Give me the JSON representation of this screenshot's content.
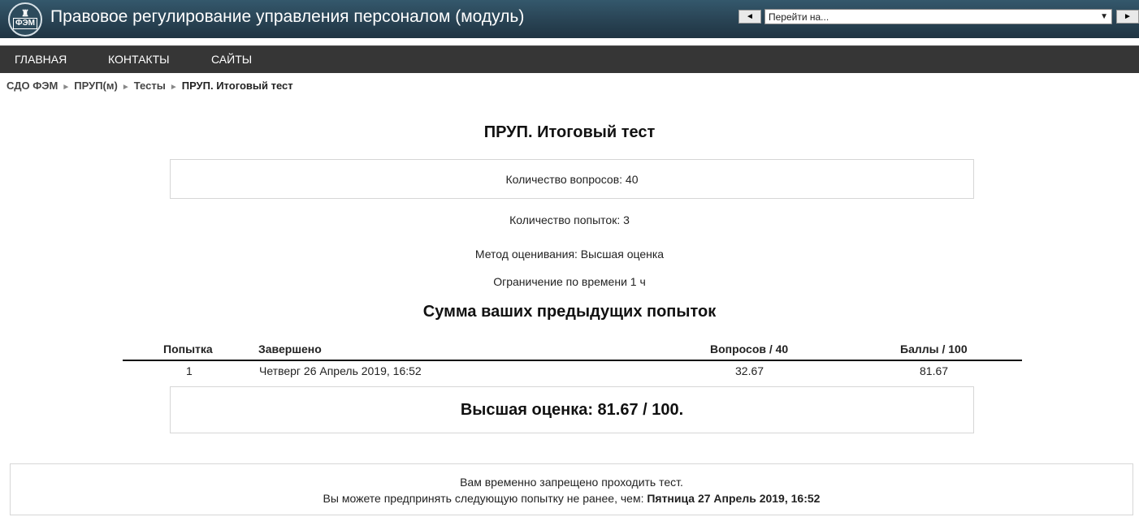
{
  "header": {
    "logo_text": "ФЭМ",
    "title": "Правовое регулирование управления персоналом (модуль)",
    "jump": {
      "prev_icon": "◄",
      "placeholder": "Перейти на...",
      "arrow_icon": "▼",
      "next_icon": "►"
    }
  },
  "nav": {
    "items": [
      {
        "label": "ГЛАВНАЯ"
      },
      {
        "label": "КОНТАКТЫ"
      },
      {
        "label": "САЙТЫ"
      }
    ]
  },
  "breadcrumb": {
    "items": [
      {
        "label": "СДО ФЭМ"
      },
      {
        "label": "ПРУП(м)"
      },
      {
        "label": "Тесты"
      },
      {
        "label": "ПРУП. Итоговый тест"
      }
    ],
    "separator": "►"
  },
  "quiz": {
    "title": "ПРУП. Итоговый тест",
    "questions": "Количество вопросов: 40",
    "attempts": "Количество попыток: 3",
    "grading": "Метод оценивания: Высшая оценка",
    "time_limit": "Ограничение по времени  1 ч"
  },
  "summary": {
    "title": "Сумма ваших предыдущих попыток",
    "columns": [
      "Попытка",
      "Завершено",
      "Вопросов / 40",
      "Баллы / 100"
    ],
    "rows": [
      {
        "attempt": "1",
        "completed": "Четверг 26 Апрель 2019, 16:52",
        "questions": "32.67",
        "score": "81.67"
      }
    ],
    "best": "Высшая оценка: 81.67 / 100."
  },
  "notice": {
    "line1": "Вам временно запрещено проходить тест.",
    "line2_prefix": "Вы можете предпринять следующую попытку не ранее, чем: ",
    "line2_date": "Пятница 27 Апрель 2019, 16:52"
  }
}
